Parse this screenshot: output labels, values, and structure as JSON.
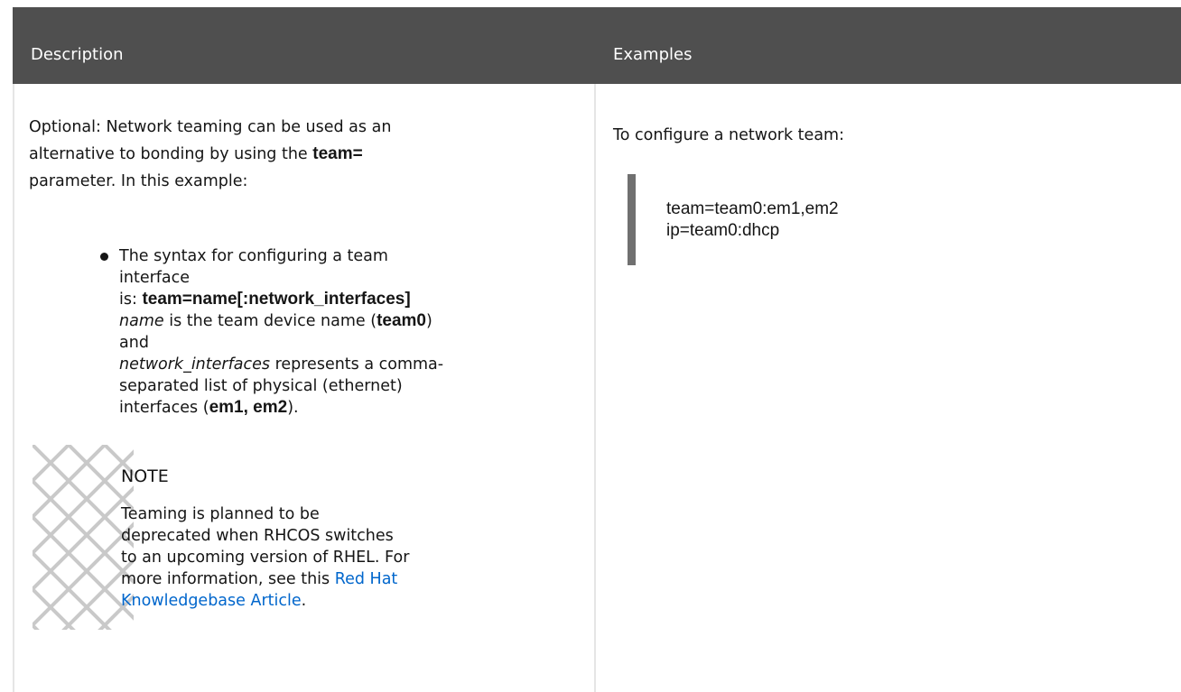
{
  "table": {
    "headers": {
      "description": "Description",
      "examples": "Examples"
    }
  },
  "description": {
    "intro_1": "Optional: Network teaming can be used as an",
    "intro_2a": "alternative to bonding by using the ",
    "intro_2b": "team=",
    "intro_3": "parameter. In this example:",
    "bullet": {
      "t1": "The syntax for configuring a team interface",
      "t2a": "is: ",
      "t2b": "team=name[:network_interfaces]",
      "t3a": "name",
      "t3b": " is the team device name (",
      "t3c": "team0",
      "t3d": ") and",
      "t4a": "network_interfaces",
      "t4b": " represents a comma-",
      "t5": "separated list of physical (ethernet)",
      "t6a": "interfaces (",
      "t6b": "em1, em2",
      "t6c": ")."
    },
    "note": {
      "title": "NOTE",
      "text_1": "Teaming is planned to be",
      "text_2": "deprecated when RHCOS switches",
      "text_3": "to an upcoming version of RHEL. For",
      "text_4a": "more information, see this ",
      "link_1": "Red Hat",
      "link_2": "Knowledgebase Article",
      "text_5": "."
    }
  },
  "examples": {
    "lead": "To configure a network team:",
    "code_1": "team=team0:em1,em2",
    "code_2": "ip=team0:dhcp"
  },
  "colors": {
    "header_bg": "#4f4f4f",
    "link": "#0066cc",
    "code_bar": "#707070"
  },
  "icons": {
    "note": "note-pattern-icon",
    "bullet": "bullet-dot-icon"
  }
}
